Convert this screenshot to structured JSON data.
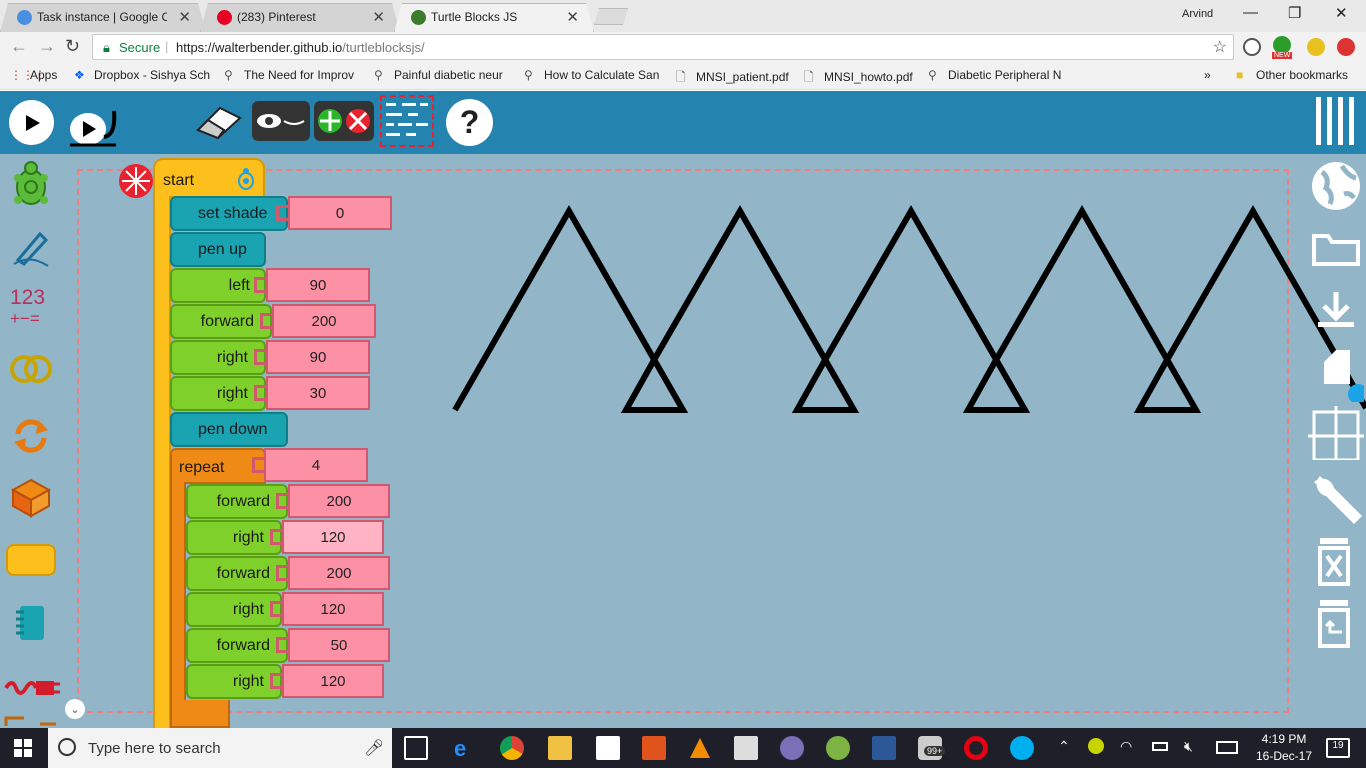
{
  "browser": {
    "tabs": [
      {
        "title": "Task instance | Google C",
        "active": false
      },
      {
        "title": "(283) Pinterest",
        "active": false
      },
      {
        "title": "Turtle Blocks JS",
        "active": true
      }
    ],
    "user": "Arvind",
    "secure_label": "Secure",
    "url_host": "https://walterbender.github.io",
    "url_path": "/turtleblocksjs/",
    "bookmarks": [
      "Apps",
      "Dropbox - Sishya Sch",
      "The Need for Improv",
      "Painful diabetic neur",
      "How to Calculate San",
      "MNSI_patient.pdf",
      "MNSI_howto.pdf",
      "Diabetic Peripheral N"
    ],
    "bookmarks_more": "»",
    "other_bookmarks": "Other bookmarks",
    "ext_badge": "NEW"
  },
  "app": {
    "palette_123": "123",
    "start_label": "start",
    "blocks": [
      {
        "name": "set shade",
        "value": "0"
      },
      {
        "name": "pen up"
      },
      {
        "name": "left",
        "value": "90"
      },
      {
        "name": "forward",
        "value": "200"
      },
      {
        "name": "right",
        "value": "90"
      },
      {
        "name": "right",
        "value": "30"
      },
      {
        "name": "pen down"
      },
      {
        "name": "repeat",
        "value": "4"
      }
    ],
    "repeat_body": [
      {
        "name": "forward",
        "value": "200"
      },
      {
        "name": "right",
        "value": "120"
      },
      {
        "name": "forward",
        "value": "200"
      },
      {
        "name": "right",
        "value": "120"
      },
      {
        "name": "forward",
        "value": "50"
      },
      {
        "name": "right",
        "value": "120"
      }
    ],
    "colors": {
      "header": "#2584af",
      "canvas": "#92b5c8",
      "teal_block": "#1aa3b1",
      "green_block": "#7fd02b",
      "orange_block": "#f08a17",
      "yellow_block": "#fcbf1b",
      "number_block": "#fc91a6"
    }
  },
  "taskbar": {
    "search_placeholder": "Type here to search",
    "time": "4:19 PM",
    "date": "16-Dec-17",
    "notifications": "19",
    "badge": "99+"
  }
}
